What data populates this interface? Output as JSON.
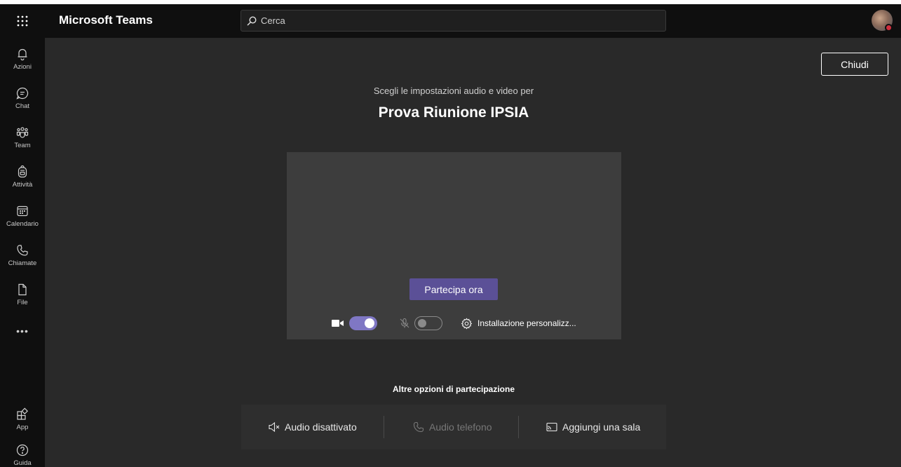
{
  "app": {
    "title": "Microsoft Teams"
  },
  "search": {
    "placeholder": "Cerca"
  },
  "rail": {
    "items": [
      {
        "label": "Azioni",
        "icon": "bell-icon"
      },
      {
        "label": "Chat",
        "icon": "chat-icon"
      },
      {
        "label": "Team",
        "icon": "team-icon"
      },
      {
        "label": "Attività",
        "icon": "backpack-icon"
      },
      {
        "label": "Calendario",
        "icon": "calendar-icon"
      },
      {
        "label": "Chiamate",
        "icon": "phone-icon"
      },
      {
        "label": "File",
        "icon": "file-icon"
      }
    ],
    "more": "•••",
    "bottom_items": [
      {
        "label": "App",
        "icon": "apps-icon"
      },
      {
        "label": "Guida",
        "icon": "help-icon"
      }
    ]
  },
  "meeting": {
    "close_label": "Chiudi",
    "subtitle": "Scegli le impostazioni audio e video per",
    "title": "Prova Riunione IPSIA",
    "join_label": "Partecipa ora",
    "camera_on": true,
    "mic_on": false,
    "custom_setup_label": "Installazione personalizz..."
  },
  "other_options": {
    "title": "Altre opzioni di partecipazione",
    "audio_off_label": "Audio disattivato",
    "phone_audio_label": "Audio telefono",
    "add_room_label": "Aggiungi una sala"
  },
  "colors": {
    "background": "#292929",
    "rail": "#0f0f0f",
    "accent": "#5b5097",
    "toggle_on": "#7f77c4",
    "preview": "#3d3d3d",
    "presence_busy": "#d12f3e"
  }
}
